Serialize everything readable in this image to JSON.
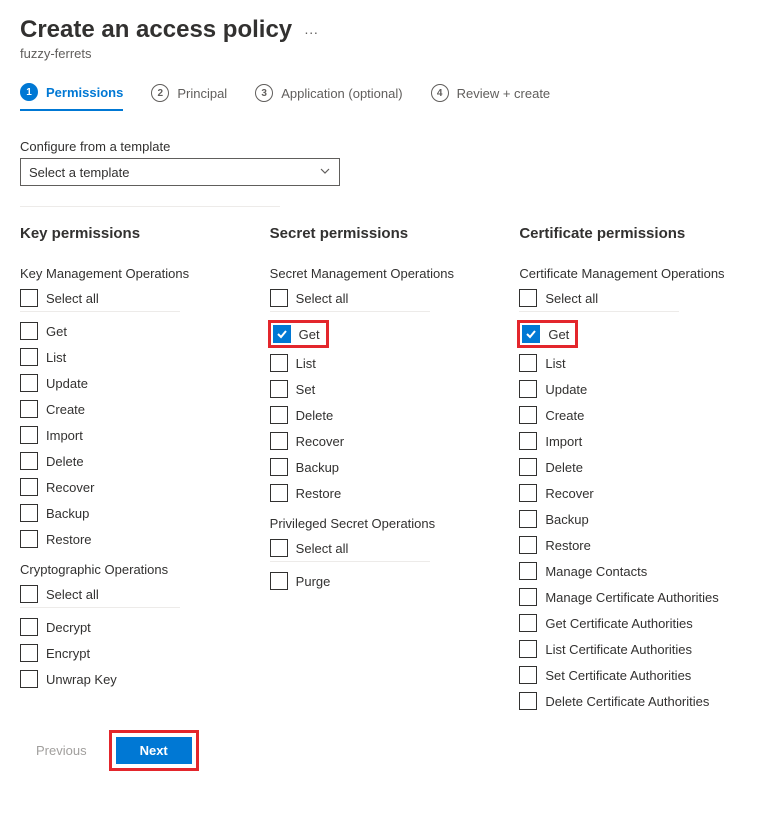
{
  "header": {
    "title": "Create an access policy",
    "subtitle": "fuzzy-ferrets"
  },
  "tabs": [
    {
      "num": "1",
      "label": "Permissions",
      "active": true
    },
    {
      "num": "2",
      "label": "Principal",
      "active": false
    },
    {
      "num": "3",
      "label": "Application (optional)",
      "active": false
    },
    {
      "num": "4",
      "label": "Review + create",
      "active": false
    }
  ],
  "template": {
    "label": "Configure from a template",
    "placeholder": "Select a template"
  },
  "columns": {
    "key": {
      "title": "Key permissions",
      "groups": [
        {
          "title": "Key Management Operations",
          "select_all": "Select all",
          "items": [
            {
              "label": "Get",
              "checked": false
            },
            {
              "label": "List",
              "checked": false
            },
            {
              "label": "Update",
              "checked": false
            },
            {
              "label": "Create",
              "checked": false
            },
            {
              "label": "Import",
              "checked": false
            },
            {
              "label": "Delete",
              "checked": false
            },
            {
              "label": "Recover",
              "checked": false
            },
            {
              "label": "Backup",
              "checked": false
            },
            {
              "label": "Restore",
              "checked": false
            }
          ]
        },
        {
          "title": "Cryptographic Operations",
          "select_all": "Select all",
          "items": [
            {
              "label": "Decrypt",
              "checked": false
            },
            {
              "label": "Encrypt",
              "checked": false
            },
            {
              "label": "Unwrap Key",
              "checked": false
            }
          ]
        }
      ]
    },
    "secret": {
      "title": "Secret permissions",
      "groups": [
        {
          "title": "Secret Management Operations",
          "select_all": "Select all",
          "items": [
            {
              "label": "Get",
              "checked": true,
              "highlight": true
            },
            {
              "label": "List",
              "checked": false
            },
            {
              "label": "Set",
              "checked": false
            },
            {
              "label": "Delete",
              "checked": false
            },
            {
              "label": "Recover",
              "checked": false
            },
            {
              "label": "Backup",
              "checked": false
            },
            {
              "label": "Restore",
              "checked": false
            }
          ]
        },
        {
          "title": "Privileged Secret Operations",
          "select_all": "Select all",
          "items": [
            {
              "label": "Purge",
              "checked": false
            }
          ]
        }
      ]
    },
    "cert": {
      "title": "Certificate permissions",
      "groups": [
        {
          "title": "Certificate Management Operations",
          "select_all": "Select all",
          "items": [
            {
              "label": "Get",
              "checked": true,
              "highlight": true
            },
            {
              "label": "List",
              "checked": false
            },
            {
              "label": "Update",
              "checked": false
            },
            {
              "label": "Create",
              "checked": false
            },
            {
              "label": "Import",
              "checked": false
            },
            {
              "label": "Delete",
              "checked": false
            },
            {
              "label": "Recover",
              "checked": false
            },
            {
              "label": "Backup",
              "checked": false
            },
            {
              "label": "Restore",
              "checked": false
            },
            {
              "label": "Manage Contacts",
              "checked": false
            },
            {
              "label": "Manage Certificate Authorities",
              "checked": false
            },
            {
              "label": "Get Certificate Authorities",
              "checked": false
            },
            {
              "label": "List Certificate Authorities",
              "checked": false
            },
            {
              "label": "Set Certificate Authorities",
              "checked": false
            },
            {
              "label": "Delete Certificate Authorities",
              "checked": false
            }
          ]
        }
      ]
    }
  },
  "footer": {
    "previous": "Previous",
    "next": "Next"
  }
}
